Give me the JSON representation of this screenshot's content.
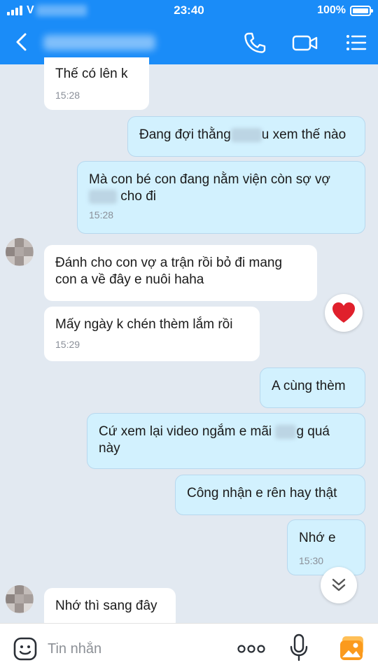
{
  "status_bar": {
    "carrier": "V",
    "time": "23:40",
    "battery": "100%"
  },
  "header": {
    "back_icon": "chevron-left-icon",
    "call_icon": "phone-icon",
    "video_icon": "video-camera-icon",
    "menu_icon": "list-menu-icon"
  },
  "messages": [
    {
      "side": "received",
      "text": "Thế có lên k",
      "time": "15:28"
    },
    {
      "side": "sent",
      "text_a": "Đang đợi thằng",
      "text_b": "u xem thế nào"
    },
    {
      "side": "sent",
      "line1": "Mà con bé con đang nằm viện còn sợ vợ",
      "line2": "cho đi",
      "time": "15:28"
    },
    {
      "side": "received",
      "line1": "Đánh cho con vợ a trận rồi bỏ đi mang",
      "line2": "con a về đây e nuôi haha"
    },
    {
      "side": "received",
      "text": "Mấy ngày k chén thèm lắm rồi",
      "time": "15:29",
      "reaction": "heart-icon"
    },
    {
      "side": "sent",
      "text": "A cùng thèm"
    },
    {
      "side": "sent",
      "line1_a": "Cứ xem lại video ngắm e mãi",
      "line1_b": "g quá",
      "line2": "này"
    },
    {
      "side": "sent",
      "text": "Công nhận e rên hay thật"
    },
    {
      "side": "sent",
      "text": "Nhớ e",
      "time": "15:30"
    },
    {
      "side": "received",
      "text": "Nhớ thì sang đây"
    }
  ],
  "input_bar": {
    "placeholder": "Tin nhắn"
  },
  "colors": {
    "header": "#1a8cf8",
    "chat_bg": "#e2e9f1",
    "sent_bubble": "#d2f1fe",
    "received_bubble": "#ffffff",
    "heart": "#e0202c"
  }
}
